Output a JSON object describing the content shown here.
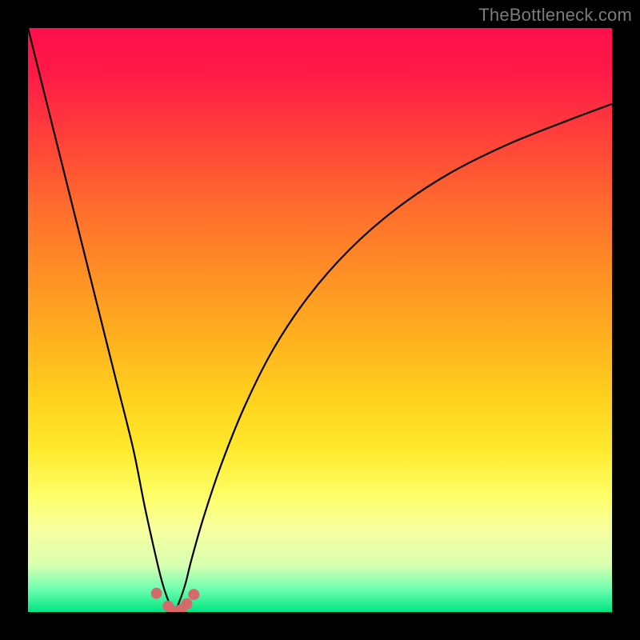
{
  "watermark": "TheBottleneck.com",
  "chart_data": {
    "type": "line",
    "title": "",
    "xlabel": "",
    "ylabel": "",
    "xlim": [
      0,
      100
    ],
    "ylim": [
      0,
      100
    ],
    "grid": false,
    "legend": false,
    "curve": {
      "name": "bottleneck-curve",
      "x": [
        0,
        3,
        6,
        9,
        12,
        15,
        18,
        20,
        22,
        23,
        24,
        25,
        26,
        27,
        28,
        30,
        33,
        37,
        42,
        48,
        55,
        63,
        72,
        82,
        92,
        100
      ],
      "y": [
        100,
        88,
        76,
        64,
        52,
        40,
        28,
        18,
        9,
        5,
        2,
        0,
        2,
        5,
        9,
        16,
        25,
        35,
        45,
        54,
        62,
        69,
        75,
        80,
        84,
        87
      ]
    },
    "markers": {
      "name": "highlight-points",
      "color": "#d66a6a",
      "x": [
        22.0,
        24.0,
        24.8,
        26.2,
        27.2,
        28.4
      ],
      "y": [
        3.2,
        1.0,
        0.2,
        0.4,
        1.4,
        3.0
      ]
    },
    "background_gradient_colors": [
      "#ff0f4a",
      "#ffd31e",
      "#00e583"
    ]
  }
}
